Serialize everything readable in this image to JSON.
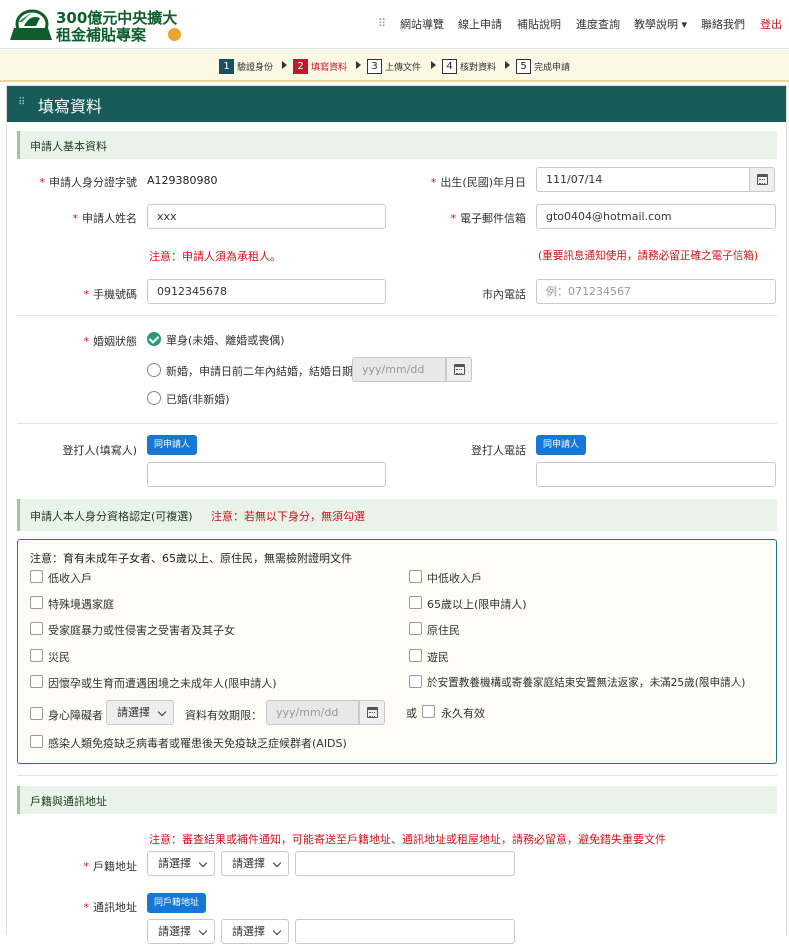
{
  "header": {
    "logo_line1": "300億元中央擴大",
    "logo_line2": "租金補貼專案",
    "nav": [
      "網站導覽",
      "線上申請",
      "補貼說明",
      "進度查詢",
      "教學說明 ▾",
      "聯絡我們"
    ],
    "logout": "登出",
    "brand_color": "#0d5e2c"
  },
  "steps": [
    {
      "num": "1",
      "label": "驗證身份",
      "state": "done"
    },
    {
      "num": "2",
      "label": "填寫資料",
      "state": "active"
    },
    {
      "num": "3",
      "label": "上傳文件",
      "state": "todo"
    },
    {
      "num": "4",
      "label": "核對資料",
      "state": "todo"
    },
    {
      "num": "5",
      "label": "完成申請",
      "state": "todo"
    }
  ],
  "card": {
    "title": "填寫資料",
    "header_color": "#185c59"
  },
  "basic": {
    "section_title": "申請人基本資料",
    "id_label": "申請人身分證字號",
    "id_value": "A129380980",
    "dob_label": "出生(民國)年月日",
    "dob_value": "111/07/14",
    "name_label": "申請人姓名",
    "name_value": "xxx",
    "email_label": "電子郵件信箱",
    "email_value": "gto0404@hotmail.com",
    "name_note": "注意：申請人須為承租人。",
    "email_note": "(重要訊息通知使用，請務必留正確之電子信箱)",
    "mobile_label": "手機號碼",
    "mobile_value": "0912345678",
    "phone_label": "市內電話",
    "phone_placeholder": "例：071234567"
  },
  "marital": {
    "label": "婚姻狀態",
    "option1": "單身(未婚、離婚或喪偶)",
    "option2": "新婚，申請日前二年內結婚，結婚日期",
    "option2_placeholder": "yyy/mm/dd",
    "option3": "已婚(非新婚)",
    "selected": "option1"
  },
  "filer": {
    "label": "登打人(填寫人)",
    "button": "同申請人",
    "phone_label": "登打人電話",
    "phone_button": "同申請人"
  },
  "qualify": {
    "section_title": "申請人本人身分資格認定(可複選)",
    "section_note": "注意：若無以下身分，無須勾選",
    "box_note": "注意：育有未成年子女者、65歲以上、原住民，無需檢附證明文件",
    "items_left": [
      "低收入戶",
      "特殊境遇家庭",
      "受家庭暴力或性侵害之受害者及其子女",
      "災民",
      "因懷孕或生育而遭遇困境之未成年人(限申請人)"
    ],
    "items_right": [
      "中低收入戶",
      "65歲以上(限申請人)",
      "原住民",
      "遊民",
      "於安置教養機構或寄養家庭結束安置無法返家，未滿25歲(限申請人)"
    ],
    "disabled_label": "身心障礙者",
    "disabled_select": "請選擇",
    "validity_label": "資料有效期限：",
    "validity_placeholder": "yyy/mm/dd",
    "or_label": "或",
    "permanent_label": "永久有效",
    "aids_label": "感染人類免疫缺乏病毒者或罹患後天免疫缺乏症候群者(AIDS)",
    "box_border_color": "#237a6c"
  },
  "address": {
    "section_title": "戶籍與通訊地址",
    "note": "注意：審查結果或補件通知，可能寄送至戶籍地址、通訊地址或租屋地址，請務必留意，避免錯失重要文件",
    "household_label": "戶籍地址",
    "mail_label": "通訊地址",
    "same_button": "同戶籍地址",
    "select1": "請選擇",
    "select2": "請選擇"
  }
}
